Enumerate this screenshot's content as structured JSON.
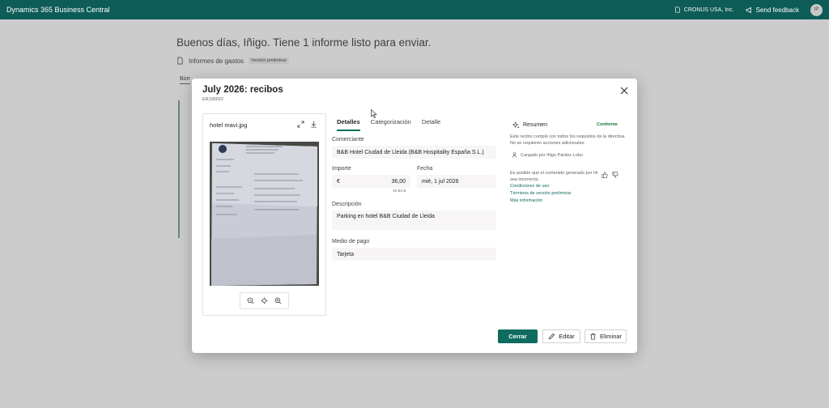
{
  "topbar": {
    "app_title": "Dynamics 365 Business Central",
    "company": "CRONUS USA, Inc.",
    "feedback": "Send feedback",
    "avatar_initials": "IP"
  },
  "background": {
    "greeting": "Buenos días, Iñigo. Tiene 1 informe listo para enviar.",
    "reports_label": "Informes de gastos",
    "preview_badge": "Versión preliminar",
    "tab": "Borr"
  },
  "modal": {
    "title": "July 2026: recibos",
    "subtitle": "ER100022",
    "image": {
      "filename": "hotel mavi.jpg"
    },
    "tabs": [
      "Detalles",
      "Categorización",
      "Detalle"
    ],
    "active_tab": "Detalles",
    "form": {
      "merchant_label": "Comerciante",
      "merchant_value": "B&B Hotel Ciudad de Lleida (B&B Hospitality España S.L.)",
      "amount_label": "Importe",
      "currency": "€",
      "amount_value": "36,00",
      "amount_helper": "33,83 $",
      "date_label": "Fecha",
      "date_value": "mié, 1 jul 2026",
      "description_label": "Descripción",
      "description_value": "Parking en hotel B&B Ciudad de Lleida",
      "payment_label": "Medio de pago",
      "payment_value": "Tarjeta"
    },
    "summary": {
      "title": "Resumen",
      "badge": "Conforme",
      "text": "Este recibo cumple con todos los requisitos de la directiva. No se requieren acciones adicionales.",
      "uploaded_by": "Cargado por Iñigo Pardos Lobo",
      "ai_note": "Es posible que el contenido generado por IA sea incorrecto.",
      "links": [
        "Condiciones de uso",
        "Términos de versión preliminar",
        "Más información"
      ]
    },
    "buttons": {
      "close": "Cerrar",
      "edit": "Editar",
      "delete": "Eliminar"
    }
  },
  "colors": {
    "brand": "#0d5c57",
    "accent": "#0f6c5f",
    "success": "#0f7b3b"
  }
}
